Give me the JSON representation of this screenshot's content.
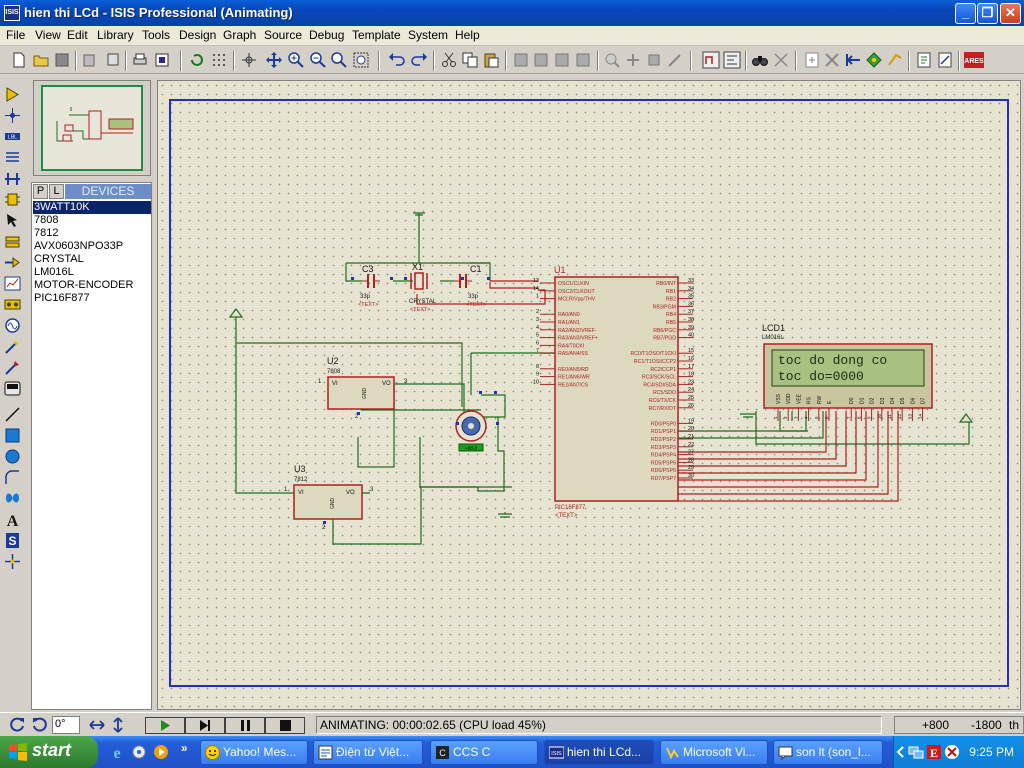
{
  "window": {
    "app_icon": "ISIS",
    "title": "hien thi LCd - ISIS Professional (Animating)"
  },
  "menu": [
    "File",
    "View",
    "Edit",
    "Library",
    "Tools",
    "Design",
    "Graph",
    "Source",
    "Debug",
    "Template",
    "System",
    "Help"
  ],
  "devices": {
    "tab_p": "P",
    "tab_l": "L",
    "header": "DEVICES",
    "items": [
      "3WATT10K",
      "7808",
      "7812",
      "AVX0603NPO33P",
      "CRYSTAL",
      "LM016L",
      "MOTOR-ENCODER",
      "PIC16F877"
    ],
    "selected_index": 0
  },
  "schematic": {
    "u1_ref": "U1",
    "u1_part": "PIC16F877",
    "u1_text": "<TEXT>",
    "u1_left_pins": [
      "OSC1/CLKIN",
      "OSC2/CLKOUT",
      "MCLR/Vpp/THV",
      "",
      "RA0/AN0",
      "RA1/AN1",
      "RA2/AN2/VREF-",
      "RA3/AN3/VREF+",
      "RA4/T0CKI",
      "RA5/AN4/SS",
      "",
      "RE0/AN5/RD",
      "RE1/AN6/WR",
      "RE2/AN7/CS"
    ],
    "u1_left_nums": [
      "13",
      "14",
      "1",
      "",
      "2",
      "3",
      "4",
      "5",
      "6",
      "7",
      "",
      "8",
      "9",
      "10"
    ],
    "u1_right_pins": [
      "RB0/INT",
      "RB1",
      "RB2",
      "RB3/PGM",
      "RB4",
      "RB5",
      "RB6/PGC",
      "RB7/PGD",
      "",
      "RC0/T1OSO/T1CKI",
      "RC1/T1OSI/CCP2",
      "RC2/CCP1",
      "RC3/SCK/SCL",
      "RC4/SDI/SDA",
      "RC5/SDO",
      "RC6/TX/CK",
      "RC7/RX/DT",
      "",
      "RD0/PSP0",
      "RD1/PSP1",
      "RD2/PSP2",
      "RD3/PSP3",
      "RD4/PSP4",
      "RD5/PSP5",
      "RD6/PSP6",
      "RD7/PSP7"
    ],
    "u1_right_nums": [
      "33",
      "34",
      "35",
      "36",
      "37",
      "38",
      "39",
      "40",
      "",
      "15",
      "16",
      "17",
      "18",
      "23",
      "24",
      "25",
      "26",
      "",
      "19",
      "20",
      "21",
      "22",
      "27",
      "28",
      "29",
      "30"
    ],
    "lcd_ref": "LCD1",
    "lcd_part": "LM016L",
    "lcd_line1": "toc do dong co",
    "lcd_line2": "toc do=0000",
    "lcd_pins": [
      "VSS",
      "VDD",
      "VEE",
      "RS",
      "RW",
      "E",
      "D0",
      "D1",
      "D2",
      "D3",
      "D4",
      "D5",
      "D6",
      "D7"
    ],
    "lcd_pin_nums": [
      "1",
      "2",
      "3",
      "4",
      "5",
      "6",
      "7",
      "8",
      "9",
      "10",
      "11",
      "12",
      "13",
      "14"
    ],
    "u2_ref": "U2",
    "u2_part": "7808",
    "u3_ref": "U3",
    "u3_part": "7812",
    "reg_vi": "VI",
    "reg_vo": "VO",
    "reg_gnd": "GND",
    "reg_pin1": "1",
    "reg_pin2": "2",
    "reg_pin3": "3",
    "x1_ref": "X1",
    "x1_part": "CRYSTAL",
    "c3_ref": "C3",
    "c1_ref": "C1",
    "cap_value": "33p",
    "text_placeholder": "<TEXT>",
    "motor_label": "+88.8"
  },
  "status": {
    "rotation": "0°",
    "text": "ANIMATING: 00:00:02.65 (CPU load 45%)",
    "coord_x": "+800",
    "coord_y": "-1800",
    "unit": "th"
  },
  "taskbar": {
    "start": "start",
    "tasks": [
      "Yahoo! Mes...",
      "Điện từ Việt...",
      "CCS C",
      "hien thi LCd...",
      "Microsoft Vi...",
      "son lt (son_l..."
    ],
    "active_index": 3,
    "clock": "9:25 PM"
  },
  "colors": {
    "title_blue": "#0846b8",
    "canvas_bg": "#e6e3d0",
    "sheet_border": "#2030c0",
    "wire": "#1f6e1f",
    "component": "#b02020",
    "lcd_bg": "#a8c080",
    "taskbar": "#245edb",
    "start_green": "#3c8f3c"
  }
}
